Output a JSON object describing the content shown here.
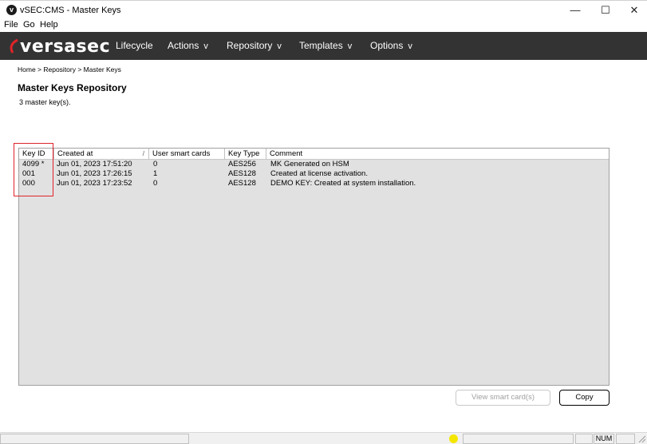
{
  "window": {
    "title": "vSEC:CMS -  Master Keys",
    "app_icon_letter": "v"
  },
  "menubar": {
    "items": [
      "File",
      "Go",
      "Help"
    ]
  },
  "navbar": {
    "logo_text": "versasec",
    "items": [
      {
        "label": "Lifecycle",
        "chevron": ""
      },
      {
        "label": "Actions",
        "chevron": "v"
      },
      {
        "label": "Repository",
        "chevron": "v"
      },
      {
        "label": "Templates",
        "chevron": "v"
      },
      {
        "label": "Options",
        "chevron": "v"
      }
    ]
  },
  "breadcrumb": "Home > Repository > Master Keys",
  "page": {
    "title": "Master Keys Repository",
    "count_text": "3 master key(s)."
  },
  "table": {
    "columns": [
      "Key ID",
      "Created at",
      "User smart cards",
      "Key Type",
      "Comment"
    ],
    "sort_indicator": "/",
    "rows": [
      [
        "4099 *",
        "Jun 01, 2023 17:51:20",
        "0",
        "AES256",
        "MK Generated on HSM"
      ],
      [
        "001",
        "Jun 01, 2023 17:26:15",
        "1",
        "AES128",
        "Created at license activation."
      ],
      [
        "000",
        "Jun 01, 2023 17:23:52",
        "0",
        "AES128",
        "DEMO KEY: Created at system installation."
      ]
    ]
  },
  "buttons": {
    "view_smart_cards": "View smart card(s)",
    "copy": "Copy"
  },
  "statusbar": {
    "num": "NUM"
  },
  "colors": {
    "navbar": "#333333",
    "highlight": "#e0242a",
    "status_light": "#f5e600",
    "list_bg": "#e1e1e1"
  }
}
